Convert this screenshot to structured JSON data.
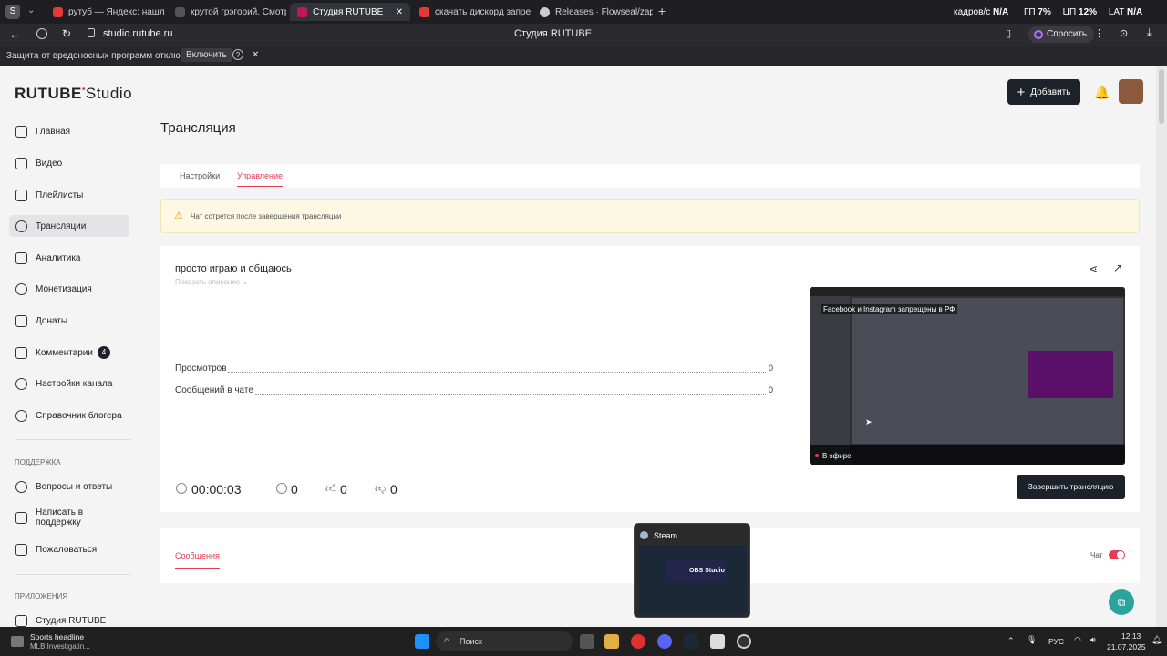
{
  "browser": {
    "tabs": [
      {
        "label": "рутуб — Яндекс: нашлось",
        "color": "#e53935"
      },
      {
        "label": "крутой грэгорий. Смотре",
        "color": "#555"
      },
      {
        "label": "Студия RUTUBE",
        "color": "#c2185b"
      },
      {
        "label": "скачать дискорд запрет",
        "color": "#e53935"
      },
      {
        "label": "Releases · Flowseal/zapret",
        "color": "#333"
      }
    ],
    "tray": {
      "fps_label": "кадров/с",
      "fps_value": "N/A",
      "gpu_label": "ГП",
      "gpu_value": "7%",
      "cpu_label": "ЦП",
      "cpu_value": "12%",
      "lat_label": "LAT",
      "lat_value": "N/A"
    },
    "url": "studio.rutube.ru",
    "page_title": "Студия RUTUBE",
    "ask_label": "Спросить",
    "security_text": "Защита от вредоносных программ отключена",
    "security_enable": "Включить"
  },
  "logo": {
    "brand": "RUTUBE",
    "suffix": "Studio"
  },
  "header": {
    "add_label": "Добавить"
  },
  "sidebar": {
    "items": [
      {
        "label": "Главная",
        "icon": "home-icon"
      },
      {
        "label": "Видео",
        "icon": "video-icon"
      },
      {
        "label": "Плейлисты",
        "icon": "playlist-icon"
      },
      {
        "label": "Трансляции",
        "icon": "broadcast-icon"
      },
      {
        "label": "Аналитика",
        "icon": "analytics-icon"
      },
      {
        "label": "Монетизация",
        "icon": "monetization-icon"
      },
      {
        "label": "Донаты",
        "icon": "donate-icon"
      },
      {
        "label": "Комментарии",
        "icon": "comments-icon",
        "badge": "4"
      },
      {
        "label": "Настройки канала",
        "icon": "gear-icon"
      },
      {
        "label": "Справочник блогера",
        "icon": "book-icon"
      }
    ],
    "support_heading": "ПОДДЕРЖКА",
    "support_items": [
      {
        "label": "Вопросы и ответы"
      },
      {
        "label": "Написать в поддержку"
      },
      {
        "label": "Пожаловаться"
      }
    ],
    "apps_heading": "ПРИЛОЖЕНИЯ",
    "apps_items": [
      {
        "label": "Студия RUTUBE"
      }
    ]
  },
  "main": {
    "title": "Трансляция",
    "tabs": [
      {
        "label": "Настройки"
      },
      {
        "label": "Управление"
      }
    ],
    "warning": "Чат сотрется после завершения трансляции",
    "stream_title": "просто играю и общаюсь",
    "show_description": "Показать описание",
    "stats": [
      {
        "label": "Просмотров",
        "value": "0"
      },
      {
        "label": "Сообщений в чате",
        "value": "0"
      }
    ],
    "timer": "00:00:03",
    "viewers": "0",
    "likes": "0",
    "dislikes": "0",
    "preview_caption": "Facebook и Instagram запрещены в РФ",
    "live_label": "В эфире",
    "end_button": "Завершить трансляцию",
    "messages_tab": "Сообщения",
    "chat_label": "Чат"
  },
  "popup": {
    "title": "Steam",
    "inner_label": "OBS Studio"
  },
  "taskbar": {
    "news_title": "Sports headline",
    "news_sub": "MLB Investigatin...",
    "search": "Поиск",
    "lang": "РУС",
    "time": "12:13",
    "date": "21.07.2025"
  },
  "colors": {
    "accent": "#e53b53",
    "dark": "#1d2129",
    "warn_bg": "#fdf8e4"
  }
}
